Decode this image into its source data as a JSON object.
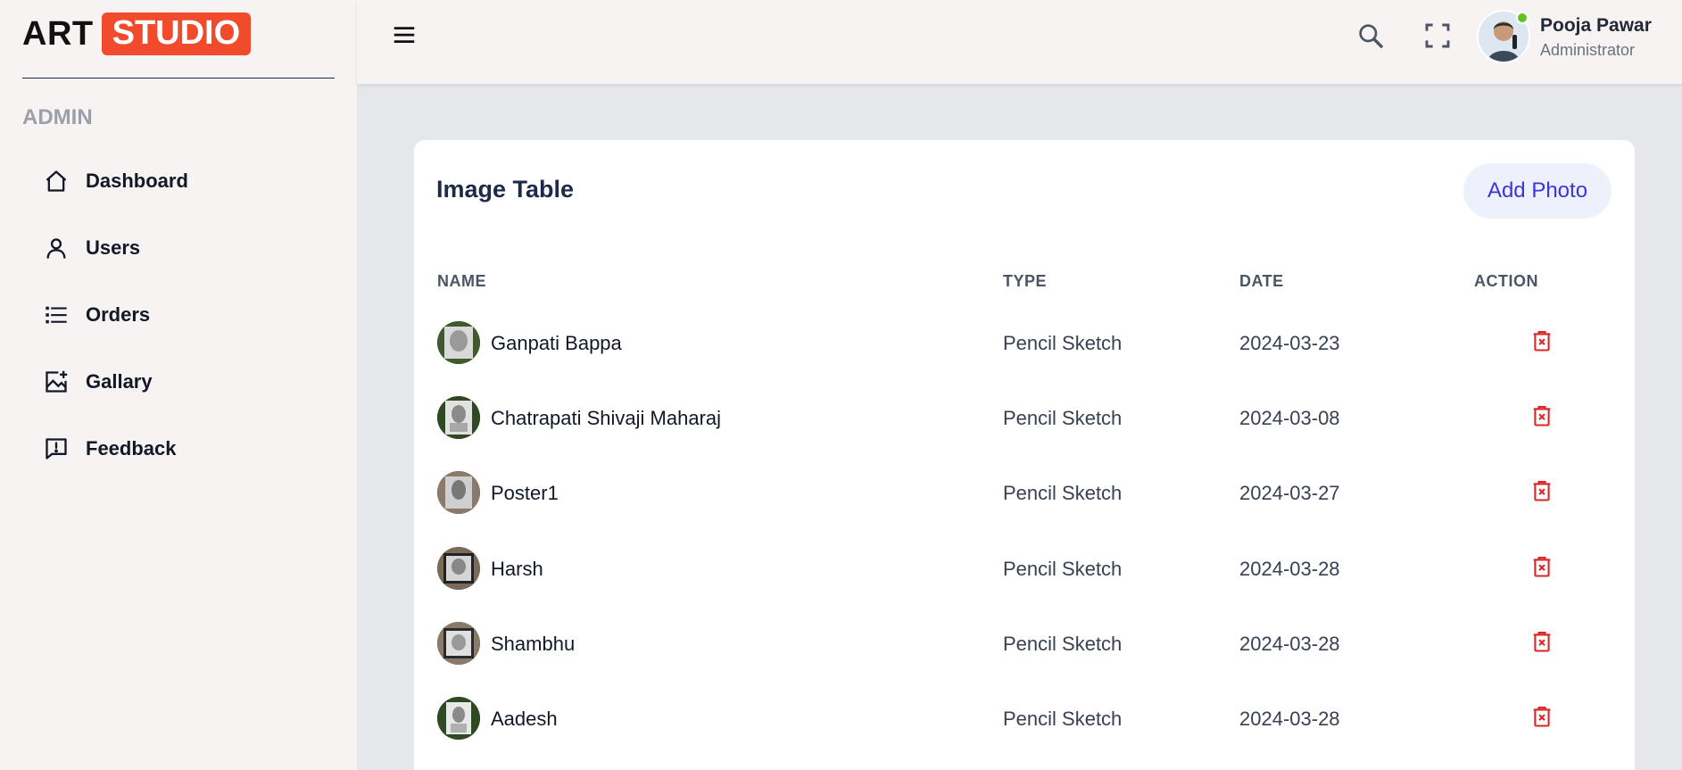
{
  "logo": {
    "art": "ART",
    "studio": "STUDIO"
  },
  "sidebar": {
    "section": "ADMIN",
    "items": [
      {
        "label": "Dashboard",
        "icon": "home-icon"
      },
      {
        "label": "Users",
        "icon": "user-icon"
      },
      {
        "label": "Orders",
        "icon": "list-icon"
      },
      {
        "label": "Gallary",
        "icon": "image-add-icon"
      },
      {
        "label": "Feedback",
        "icon": "feedback-icon"
      }
    ]
  },
  "header": {
    "user_name": "Pooja Pawar",
    "user_role": "Administrator",
    "online_color": "#62c21f"
  },
  "card": {
    "title": "Image Table",
    "add_button": "Add Photo",
    "columns": [
      "NAME",
      "TYPE",
      "DATE",
      "ACTION"
    ],
    "rows": [
      {
        "name": "Ganpati Bappa",
        "type": "Pencil Sketch",
        "date": "2024-03-23"
      },
      {
        "name": "Chatrapati Shivaji Maharaj",
        "type": "Pencil Sketch",
        "date": "2024-03-08"
      },
      {
        "name": "Poster1",
        "type": "Pencil Sketch",
        "date": "2024-03-27"
      },
      {
        "name": "Harsh",
        "type": "Pencil Sketch",
        "date": "2024-03-28"
      },
      {
        "name": "Shambhu",
        "type": "Pencil Sketch",
        "date": "2024-03-28"
      },
      {
        "name": "Aadesh",
        "type": "Pencil Sketch",
        "date": "2024-03-28"
      }
    ]
  },
  "colors": {
    "brand": "#f24a2c",
    "accent": "#3b34d9",
    "danger": "#dc2626"
  }
}
